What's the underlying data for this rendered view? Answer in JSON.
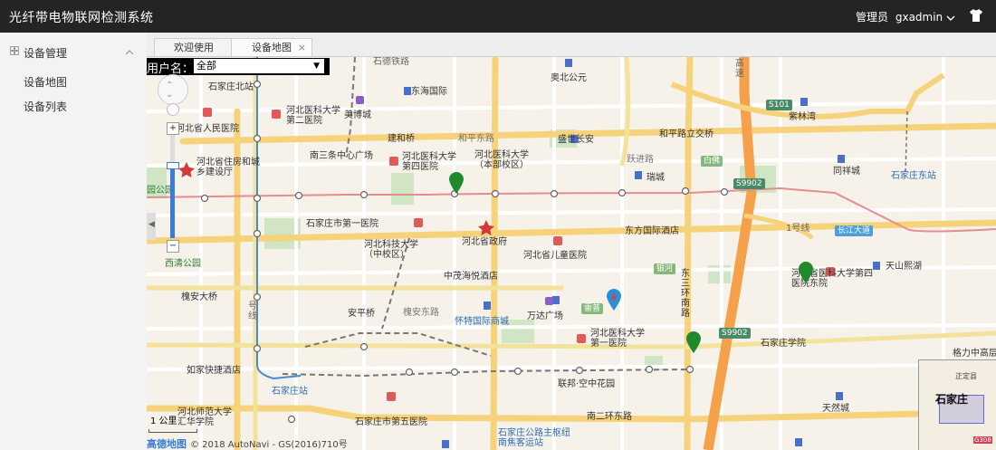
{
  "app": {
    "title": "光纤带电物联网检测系统",
    "admin_label": "管理员",
    "username": "gxadmin"
  },
  "sidebar": {
    "section": "设备管理",
    "items": [
      {
        "label": "设备地图"
      },
      {
        "label": "设备列表"
      }
    ]
  },
  "tabs": [
    {
      "label": "欢迎使用",
      "active": false
    },
    {
      "label": "设备地图",
      "active": true,
      "close": "×"
    }
  ],
  "filter": {
    "label": "用户名：",
    "selected": "全部"
  },
  "map": {
    "scale": "1 公里",
    "copyright_logo": "高德地图",
    "copyright": "© 2018 AutoNavi - GS(2016)710号",
    "minimap": {
      "city": "石家庄",
      "sub": "正定县",
      "road": "G308"
    },
    "labels": {
      "l01": "石家庄北站",
      "l02": "河北省人民医院",
      "l03": "河北医科大学第二医院",
      "l04": "美博城",
      "l05": "东海国际",
      "l06": "奥北公元",
      "l07": "紫林湾",
      "l08": "和平东路",
      "l09": "盛世长安",
      "l10": "建和桥",
      "l11": "南三条中心广场",
      "l12": "河北医科大学第四医院",
      "l13": "河北医科大学（本部校区）",
      "l14": "和平路立交桥",
      "l15": "跃进路",
      "l16": "瑞城",
      "l17": "同祥城",
      "l18": "石家庄东站",
      "l19": "河北省住房和城乡建设厅",
      "l20": "石家庄市第一医院",
      "l21": "河北省政府",
      "l22": "东方国际酒店",
      "l23": "河北科技大学（中校区）",
      "l24": "河北省儿童医院",
      "l25": "中茂海悦酒店",
      "l26": "西清公园",
      "l27": "槐安大桥",
      "l28": "安平桥",
      "l29": "槐安东路",
      "l30": "怀特国际商城",
      "l31": "万达广场",
      "l32": "河北医科大学第一医院",
      "l33": "东三环南路",
      "l34": "河北省医科大学第四医院东院",
      "l35": "天山熙湖",
      "l36": "石家庄学院",
      "l37": "如家快捷酒店",
      "l38": "石家庄站",
      "l39": "联邦·空中花园",
      "l40": "南二环东路",
      "l41": "河北师范大学汇华学院",
      "l42": "石家庄市第五医院",
      "l43": "石家庄公路主枢纽南焦客运站",
      "l44": "天然城",
      "l45": "格力中高层",
      "l46": "长江大道",
      "l47": "1号线",
      "l48": "高速",
      "l49": "S9902",
      "l50": "S101",
      "l51": "白佛",
      "l52": "银河",
      "l53": "雷普",
      "l54": "园公园",
      "l55": "号线",
      "l56": "石德铁路",
      "l57": "河北医科大学",
      "l58": "和平东路"
    },
    "markers": [
      "green-device-marker",
      "green-device-marker",
      "green-device-marker"
    ]
  }
}
